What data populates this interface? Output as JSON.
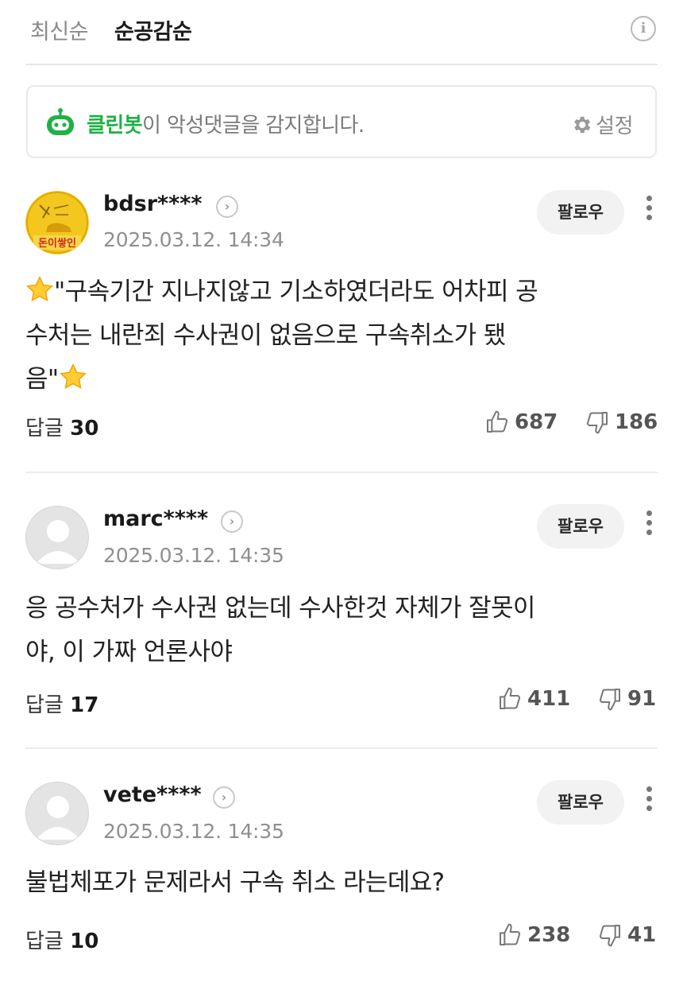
{
  "sort": {
    "options": [
      "최신순",
      "순공감순"
    ],
    "active_index": 1,
    "info_glyph": "i"
  },
  "cleanbot": {
    "brand": "클린봇",
    "message": "이 악성댓글을 감지합니다.",
    "settings_label": "설정",
    "brand_color": "#1fb146"
  },
  "comments": [
    {
      "username": "bdsr****",
      "timestamp": "2025.03.12. 14:34",
      "follow_label": "팔로우",
      "avatar": "custom-image-avatar",
      "text_lines": [
        "\"구속기간 지나지않고 기소하였더라도 어차피 공",
        "수처는 내란죄 수사권이 없음으로 구속취소가 됐",
        "음\""
      ],
      "reply_label": "답글",
      "reply_count": "30",
      "likes": "687",
      "dislikes": "186"
    },
    {
      "username": "marc****",
      "timestamp": "2025.03.12. 14:35",
      "follow_label": "팔로우",
      "avatar": "default-user-avatar",
      "text_lines": [
        "응 공수처가 수사권 없는데 수사한것 자체가 잘못이",
        "야, 이 가짜 언론사야"
      ],
      "reply_label": "답글",
      "reply_count": "17",
      "likes": "411",
      "dislikes": "91"
    },
    {
      "username": "vete****",
      "timestamp": "2025.03.12. 14:35",
      "follow_label": "팔로우",
      "avatar": "default-user-avatar",
      "text_lines": [
        "불법체포가 문제라서 구속 취소 라는데요?"
      ],
      "reply_label": "답글",
      "reply_count": "10",
      "likes": "238",
      "dislikes": "41"
    }
  ],
  "avatar_image_text": "돈이쌓인"
}
